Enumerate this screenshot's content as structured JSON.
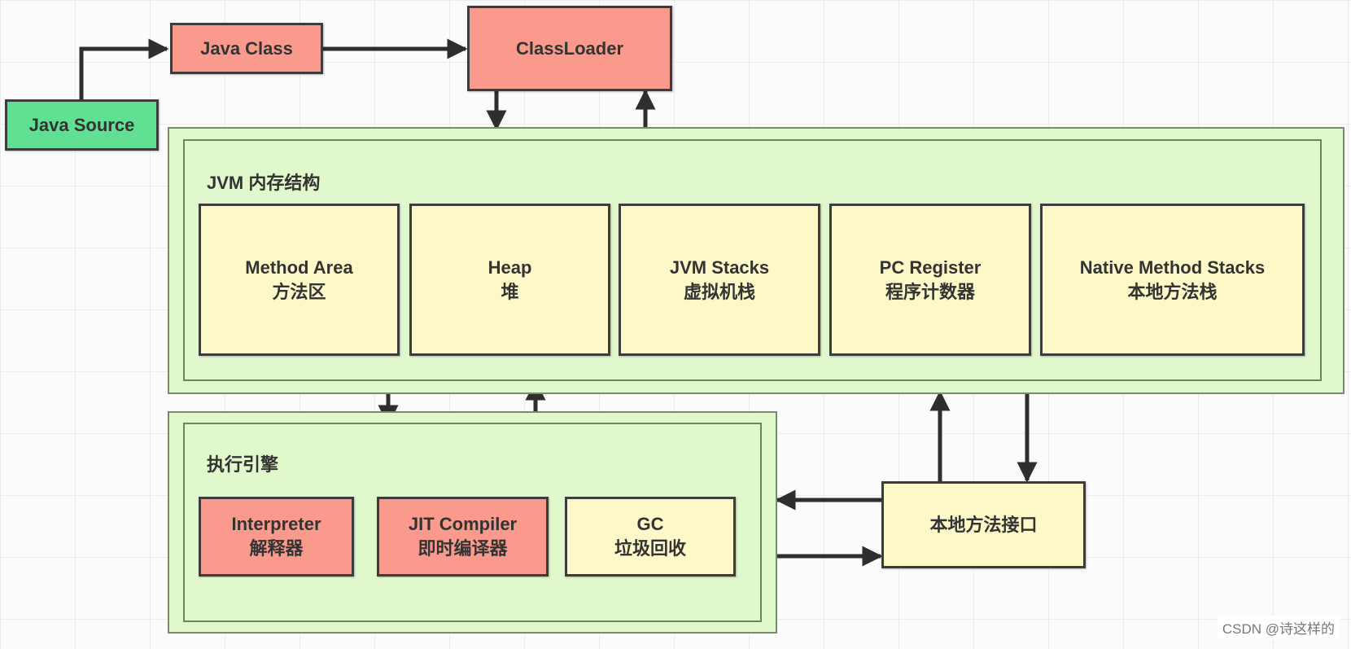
{
  "inputs": {
    "java_source": "Java Source",
    "java_class": "Java Class",
    "class_loader": "ClassLoader"
  },
  "jvm_memory": {
    "title": "JVM 内存结构",
    "areas": [
      {
        "en": "Method Area",
        "zh": "方法区"
      },
      {
        "en": "Heap",
        "zh": "堆"
      },
      {
        "en": "JVM Stacks",
        "zh": "虚拟机栈"
      },
      {
        "en": "PC Register",
        "zh": "程序计数器"
      },
      {
        "en": "Native Method Stacks",
        "zh": "本地方法栈"
      }
    ]
  },
  "execution_engine": {
    "title": "执行引擎",
    "components": [
      {
        "en": "Interpreter",
        "zh": "解释器"
      },
      {
        "en": "JIT Compiler",
        "zh": "即时编译器"
      },
      {
        "en": "GC",
        "zh": "垃圾回收"
      }
    ]
  },
  "native_interface": {
    "label": "本地方法接口"
  },
  "colors": {
    "red": "#fa9a8c",
    "green": "#5fe092",
    "yellow": "#fdf8c8",
    "panel": "#e1f7cc"
  },
  "watermark": "CSDN @诗这样的"
}
